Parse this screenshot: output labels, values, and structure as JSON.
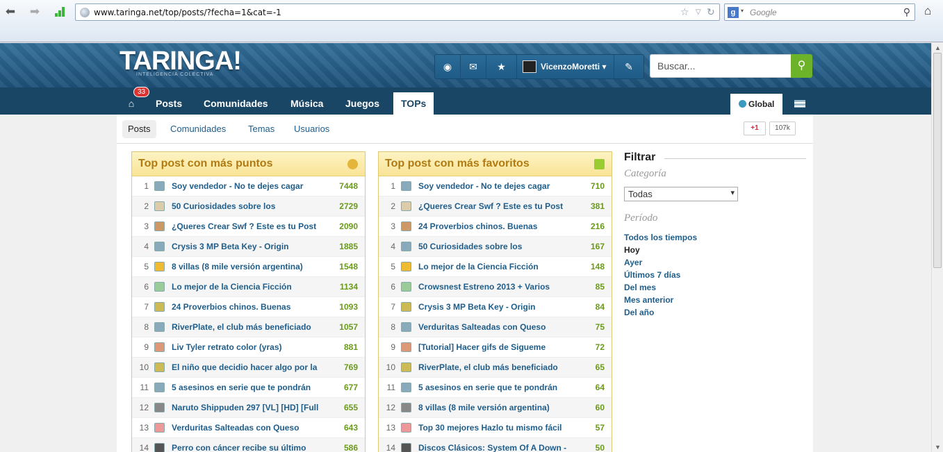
{
  "browser": {
    "url": "www.taringa.net/top/posts/?fecha=1&cat=-1",
    "search_placeholder": "Google"
  },
  "site": {
    "logo": "TARINGA!",
    "tagline": "INTELIGENCIA COLECTIVA"
  },
  "header": {
    "username": "VicenzoMoretti ▾",
    "search_placeholder": "Buscar..."
  },
  "nav": {
    "badge": "33",
    "items": [
      "Posts",
      "Comunidades",
      "Música",
      "Juegos",
      "TOPs"
    ],
    "region": "Global"
  },
  "subnav": {
    "items": [
      "Posts",
      "Comunidades",
      "Temas",
      "Usuarios"
    ],
    "gplus": "+1",
    "gcount": "107k"
  },
  "box1": {
    "title": "Top post con más puntos",
    "rows": [
      {
        "n": "1",
        "t": "Soy vendedor - No te dejes cagar",
        "p": "7448"
      },
      {
        "n": "2",
        "t": "50 Curiosidades sobre los",
        "p": "2729"
      },
      {
        "n": "3",
        "t": "¿Queres Crear Swf ? Este es tu Post",
        "p": "2090"
      },
      {
        "n": "4",
        "t": "Crysis 3 MP Beta Key - Origin",
        "p": "1885"
      },
      {
        "n": "5",
        "t": "8 villas (8 mile versión argentina)",
        "p": "1548"
      },
      {
        "n": "6",
        "t": "Lo mejor de la Ciencia Ficción",
        "p": "1134"
      },
      {
        "n": "7",
        "t": "24 Proverbios chinos. Buenas",
        "p": "1093"
      },
      {
        "n": "8",
        "t": "RiverPlate, el club más beneficiado",
        "p": "1057"
      },
      {
        "n": "9",
        "t": "Liv Tyler retrato color (yras)",
        "p": "881"
      },
      {
        "n": "10",
        "t": "El niño que decidio hacer algo por la",
        "p": "769"
      },
      {
        "n": "11",
        "t": "5 asesinos en serie que te pondrán",
        "p": "677"
      },
      {
        "n": "12",
        "t": "Naruto Shippuden 297 [VL] [HD] [Full",
        "p": "655"
      },
      {
        "n": "13",
        "t": "Verduritas Salteadas con Queso",
        "p": "643"
      },
      {
        "n": "14",
        "t": "Perro con cáncer recibe su último",
        "p": "586"
      }
    ]
  },
  "box2": {
    "title": "Top post con más favoritos",
    "rows": [
      {
        "n": "1",
        "t": "Soy vendedor - No te dejes cagar",
        "p": "710"
      },
      {
        "n": "2",
        "t": "¿Queres Crear Swf ? Este es tu Post",
        "p": "381"
      },
      {
        "n": "3",
        "t": "24 Proverbios chinos. Buenas",
        "p": "216"
      },
      {
        "n": "4",
        "t": "50 Curiosidades sobre los",
        "p": "167"
      },
      {
        "n": "5",
        "t": "Lo mejor de la Ciencia Ficción",
        "p": "148"
      },
      {
        "n": "6",
        "t": "Crowsnest Estreno 2013 + Varios",
        "p": "85"
      },
      {
        "n": "7",
        "t": "Crysis 3 MP Beta Key - Origin",
        "p": "84"
      },
      {
        "n": "8",
        "t": "Verduritas Salteadas con Queso",
        "p": "75"
      },
      {
        "n": "9",
        "t": "[Tutorial] Hacer gifs de Sigueme",
        "p": "72"
      },
      {
        "n": "10",
        "t": "RiverPlate, el club más beneficiado",
        "p": "65"
      },
      {
        "n": "11",
        "t": "5 asesinos en serie que te pondrán",
        "p": "64"
      },
      {
        "n": "12",
        "t": "8 villas (8 mile versión argentina)",
        "p": "60"
      },
      {
        "n": "13",
        "t": "Top 30 mejores Hazlo tu mismo fácil",
        "p": "57"
      },
      {
        "n": "14",
        "t": "Discos Clásicos: System Of A Down -",
        "p": "50"
      }
    ]
  },
  "filter": {
    "title": "Filtrar",
    "category_label": "Categoría",
    "category_value": "Todas",
    "period_label": "Período",
    "periods": [
      "Todos los tiempos",
      "Hoy",
      "Ayer",
      "Últimos 7 días",
      "Del mes",
      "Mes anterior",
      "Del año"
    ]
  }
}
